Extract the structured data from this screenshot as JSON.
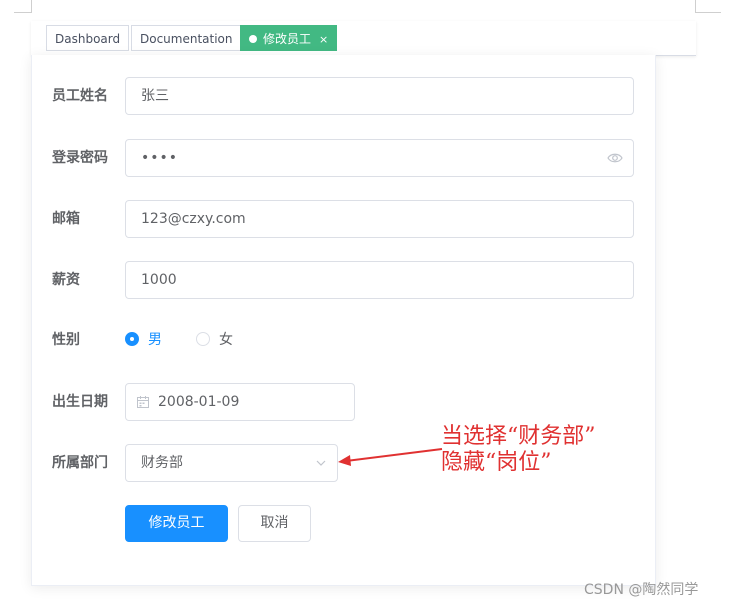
{
  "tags": [
    {
      "label": "Dashboard",
      "active": false
    },
    {
      "label": "Documentation",
      "active": false
    },
    {
      "label": "修改员工",
      "active": true,
      "close": "×"
    }
  ],
  "form": {
    "name": {
      "label": "员工姓名",
      "value": "张三"
    },
    "password": {
      "label": "登录密码",
      "value": "••••"
    },
    "email": {
      "label": "邮箱",
      "value": "123@czxy.com"
    },
    "salary": {
      "label": "薪资",
      "value": "1000"
    },
    "gender": {
      "label": "性别",
      "options": [
        "男",
        "女"
      ],
      "selected": "男"
    },
    "birthday": {
      "label": "出生日期",
      "value": "2008-01-09"
    },
    "department": {
      "label": "所属部门",
      "value": "财务部"
    }
  },
  "buttons": {
    "submit": "修改员工",
    "cancel": "取消"
  },
  "annotation": {
    "line1": "当选择“财务部”",
    "line2": "隐藏“岗位”"
  },
  "watermark": "CSDN @陶然同学",
  "colors": {
    "primary": "#1890ff",
    "tag_active": "#42b983",
    "annotation": "#e03131"
  }
}
